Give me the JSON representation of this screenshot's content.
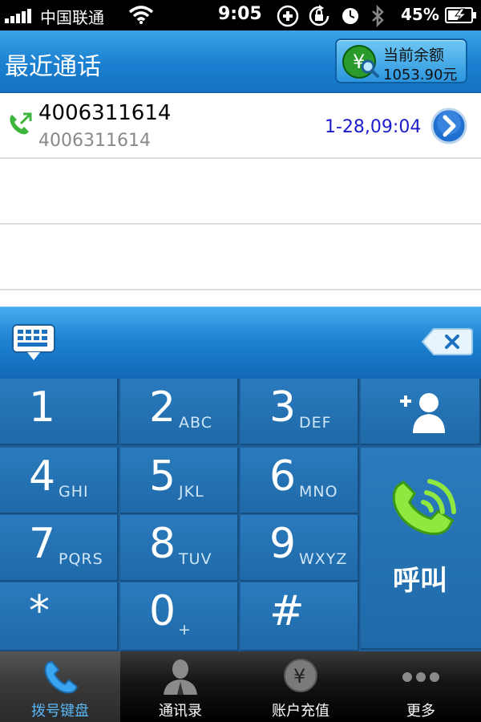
{
  "status_bar": {
    "carrier": "中国联通",
    "time": "9:05",
    "battery_percent": "45%"
  },
  "header": {
    "title": "最近通话",
    "balance_label": "当前余额",
    "balance_value": "1053.90元"
  },
  "call_log": [
    {
      "name": "4006311614",
      "number": "4006311614",
      "time": "1-28,09:04",
      "icon": "outgoing-call-icon"
    }
  ],
  "dialer": {
    "input_value": ""
  },
  "keypad": {
    "keys": [
      {
        "digit": "1",
        "letters": ""
      },
      {
        "digit": "2",
        "letters": "ABC"
      },
      {
        "digit": "3",
        "letters": "DEF"
      },
      {
        "digit": "4",
        "letters": "GHI"
      },
      {
        "digit": "5",
        "letters": "JKL"
      },
      {
        "digit": "6",
        "letters": "MNO"
      },
      {
        "digit": "7",
        "letters": "PQRS"
      },
      {
        "digit": "8",
        "letters": "TUV"
      },
      {
        "digit": "9",
        "letters": "WXYZ"
      },
      {
        "digit": "*",
        "letters": ""
      },
      {
        "digit": "0",
        "letters": "+"
      },
      {
        "digit": "#",
        "letters": ""
      }
    ],
    "call_label": "呼叫"
  },
  "tabbar": {
    "items": [
      {
        "label": "拨号键盘",
        "icon": "phone-icon",
        "active": true
      },
      {
        "label": "通讯录",
        "icon": "contacts-icon",
        "active": false
      },
      {
        "label": "账户充值",
        "icon": "yuan-coin-icon",
        "active": false
      },
      {
        "label": "更多",
        "icon": "more-dots-icon",
        "active": false
      }
    ]
  },
  "colors": {
    "header_blue": "#1a7fd0",
    "keypad_blue": "#2a7bbe",
    "call_green": "#7ee23a",
    "time_text": "#1c1ccc",
    "active_tab_label": "#5ab6f5"
  }
}
